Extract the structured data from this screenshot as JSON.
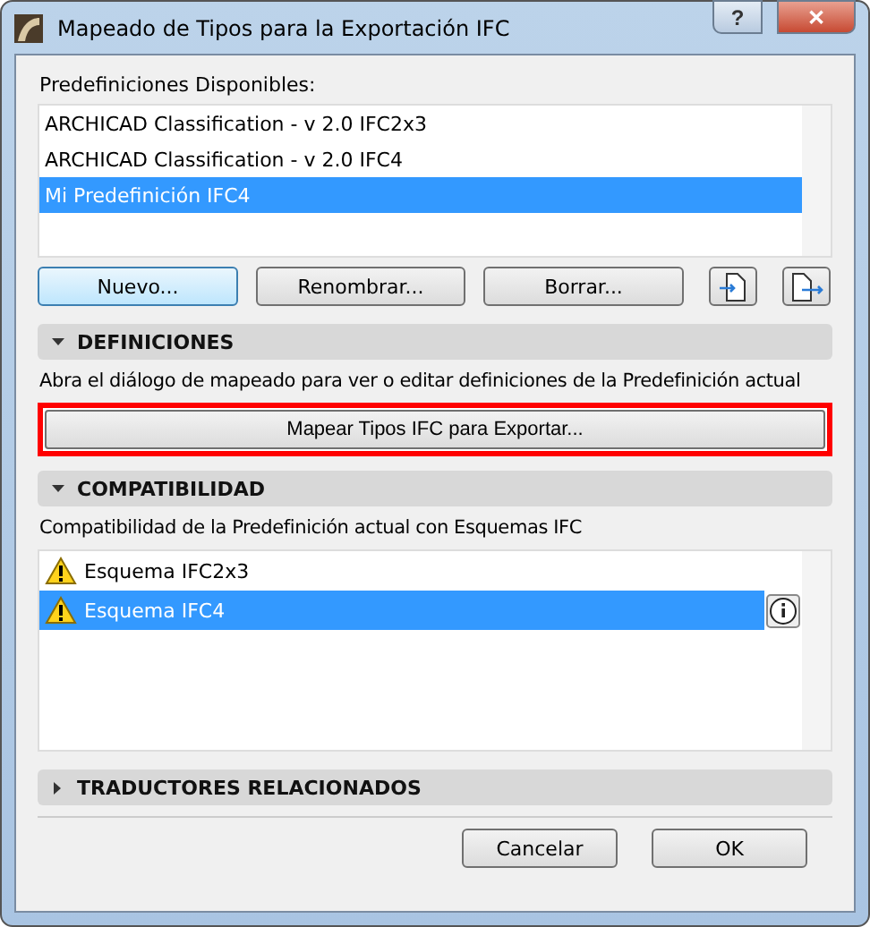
{
  "window": {
    "title": "Mapeado de Tipos para la Exportación IFC",
    "help": "?",
    "close": "✕"
  },
  "presets": {
    "label": "Predefiniciones Disponibles:",
    "items": [
      {
        "name": "ARCHICAD Classification - v 2.0 IFC2x3",
        "selected": false
      },
      {
        "name": "ARCHICAD Classification - v 2.0 IFC4",
        "selected": false
      },
      {
        "name": "Mi Predefinición IFC4",
        "selected": true
      }
    ],
    "buttons": [
      {
        "label": "Nuevo...",
        "focused": true
      },
      {
        "label": "Renombrar...",
        "focused": false
      },
      {
        "label": "Borrar...",
        "focused": false
      }
    ]
  },
  "sections": [
    {
      "kind": "definitions",
      "title": "DEFINICIONES",
      "expanded": true,
      "text": "Abra el diálogo de mapeado para ver o editar definiciones de la Predefinición actual",
      "button": {
        "label": "Mapear Tipos IFC para Exportar...",
        "highlighted": true
      }
    },
    {
      "kind": "compat",
      "title": "COMPATIBILIDAD",
      "expanded": true,
      "text": "Compatibilidad de la Predefinición actual con Esquemas IFC",
      "items": [
        {
          "name": "Esquema IFC2x3",
          "selected": false
        },
        {
          "name": "Esquema IFC4",
          "selected": true
        }
      ]
    },
    {
      "title": "TRADUCTORES RELACIONADOS",
      "expanded": false
    }
  ],
  "footer": [
    "Cancelar",
    "OK"
  ]
}
